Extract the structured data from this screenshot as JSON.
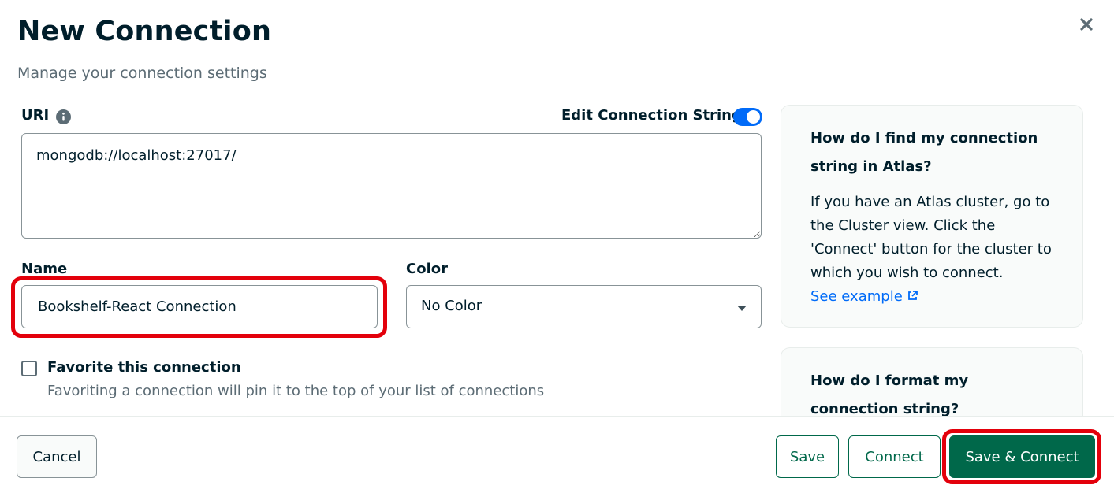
{
  "dialog": {
    "title": "New Connection",
    "subtitle": "Manage your connection settings",
    "close_icon": "close-icon"
  },
  "uri": {
    "label": "URI",
    "info_icon": "info-icon",
    "edit_toggle_label": "Edit Connection String",
    "edit_toggle_on": true,
    "value": "mongodb://localhost:27017/"
  },
  "name": {
    "label": "Name",
    "value": "Bookshelf-React Connection"
  },
  "color": {
    "label": "Color",
    "selected": "No Color"
  },
  "favorite": {
    "label": "Favorite this connection",
    "description": "Favoriting a connection will pin it to the top of your list of connections",
    "checked": false
  },
  "help": {
    "panel1": {
      "heading_line1": "How do I find my connection",
      "heading_line2": "string in Atlas?",
      "body_lines": [
        "If you have an Atlas cluster, go to",
        "the Cluster view. Click the",
        "'Connect' button for the cluster to",
        "which you wish to connect."
      ],
      "link": "See example"
    },
    "panel2": {
      "heading_line1": "How do I format my",
      "heading_line2": "connection string?"
    }
  },
  "footer": {
    "cancel": "Cancel",
    "save": "Save",
    "connect": "Connect",
    "save_connect": "Save & Connect"
  },
  "colors": {
    "primary_green": "#00684a",
    "toggle_blue": "#016bf8",
    "highlight_red": "#e3000b",
    "text_dark": "#001e2b",
    "text_muted": "#5c6c75"
  }
}
